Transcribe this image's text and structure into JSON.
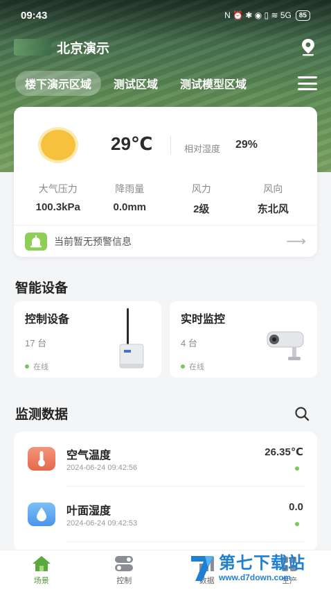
{
  "status_bar": {
    "time": "09:43",
    "icons": "N ⏰ ✱ ◉ ▯ ≋ 5G",
    "battery": "85"
  },
  "header": {
    "city": "北京演示",
    "location_icon": "location-pin-icon"
  },
  "tabs": [
    {
      "label": "楼下演示区域",
      "active": true
    },
    {
      "label": "测试区域",
      "active": false
    },
    {
      "label": "测试模型区域",
      "active": false
    }
  ],
  "weather": {
    "temperature": "29℃",
    "humidity_label": "相对湿度",
    "humidity_value": "29%",
    "stats": [
      {
        "label": "大气压力",
        "value": "100.3kPa"
      },
      {
        "label": "降雨量",
        "value": "0.0mm"
      },
      {
        "label": "风力",
        "value": "2级"
      },
      {
        "label": "风向",
        "value": "东北风"
      }
    ],
    "alert_text": "当前暂无预警信息"
  },
  "devices": {
    "title": "智能设备",
    "cards": [
      {
        "name": "控制设备",
        "count": "17 台",
        "status": "在线"
      },
      {
        "name": "实时监控",
        "count": "4 台",
        "status": "在线"
      }
    ]
  },
  "monitor": {
    "title": "监测数据",
    "rows": [
      {
        "name": "空气温度",
        "time": "2024-06-24 09:42:56",
        "value": "26.35℃"
      },
      {
        "name": "叶面湿度",
        "time": "2024-06-24 09:42:53",
        "value": "0.0"
      }
    ]
  },
  "bottom_nav": [
    {
      "label": "场景",
      "active": true
    },
    {
      "label": "控制",
      "active": false
    },
    {
      "label": "数据",
      "active": false
    },
    {
      "label": "生产",
      "active": false
    }
  ],
  "watermark": {
    "title": "第七下载站",
    "url": "www.d7down.com"
  },
  "colors": {
    "accent_green": "#4f9d3a",
    "online_dot": "#7fc35b",
    "temp_icon": "#ef7a5b",
    "humidity_icon": "#5aa8f0"
  }
}
